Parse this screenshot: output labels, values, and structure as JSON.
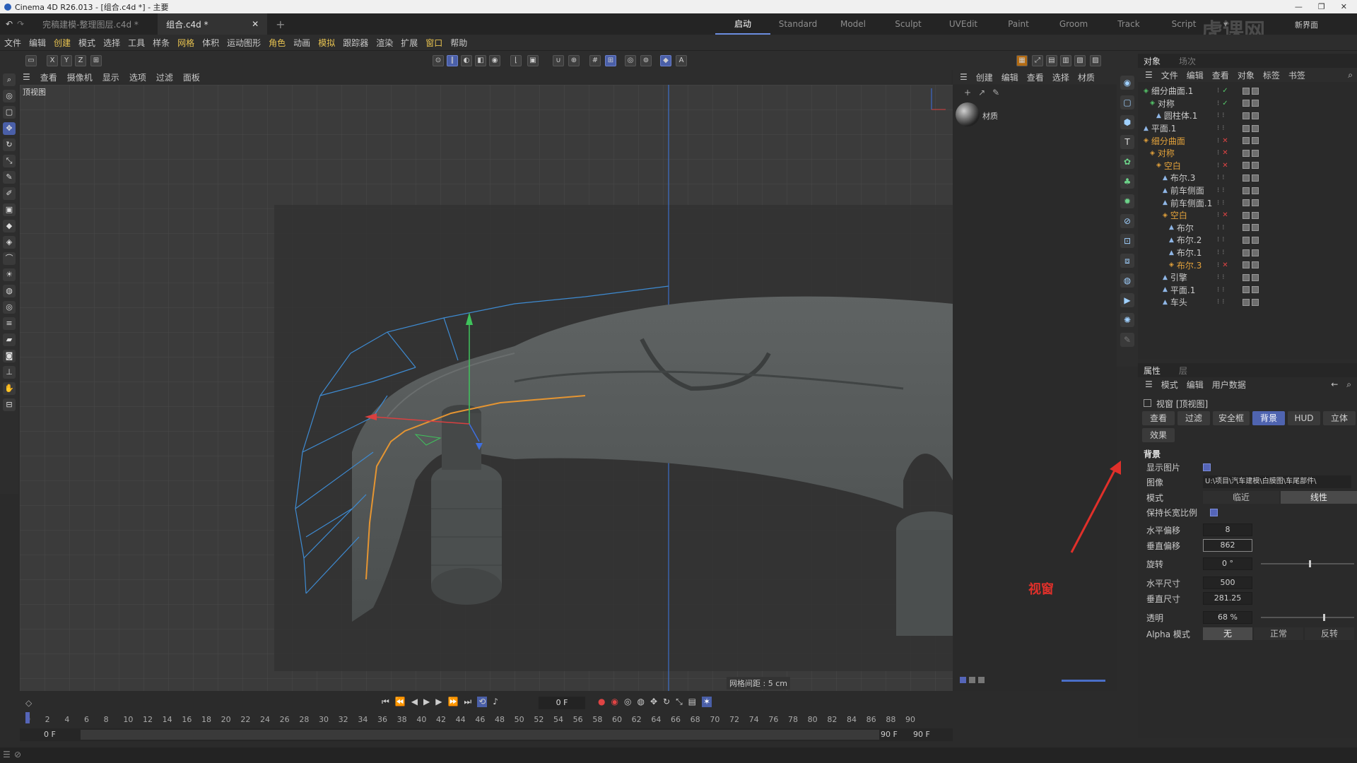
{
  "window": {
    "title": "Cinema 4D R26.013 - [组合.c4d *] - 主要",
    "controls": [
      "—",
      "❐",
      "✕"
    ]
  },
  "tabs": {
    "doc1": "完稿建模-整理图层.c4d *",
    "doc2": "组合.c4d *",
    "add": "+",
    "layouts": [
      "启动",
      "Standard",
      "Model",
      "Sculpt",
      "UVEdit",
      "Paint",
      "Groom",
      "Track",
      "Script"
    ],
    "new_layout": "新界面"
  },
  "menu": [
    "文件",
    "编辑",
    "创建",
    "模式",
    "选择",
    "工具",
    "样条",
    "网格",
    "体积",
    "运动图形",
    "角色",
    "动画",
    "模拟",
    "跟踪器",
    "渲染",
    "扩展",
    "窗口",
    "帮助"
  ],
  "toolbar": {
    "axes": [
      "X",
      "Y",
      "Z"
    ]
  },
  "viewport": {
    "menu": [
      "查看",
      "摄像机",
      "显示",
      "选项",
      "过滤",
      "面板"
    ],
    "label": "顶视图",
    "grid_spacing": "网格间距 : 5 cm"
  },
  "material": {
    "menu": [
      "创建",
      "编辑",
      "查看",
      "选择",
      "材质"
    ],
    "name": "材质"
  },
  "objects": {
    "tabs": [
      "对象",
      "场次"
    ],
    "menu": [
      "文件",
      "编辑",
      "查看",
      "对象",
      "标签",
      "书签"
    ],
    "rows": [
      {
        "name": "细分曲面.1",
        "indent": 0,
        "state": "green"
      },
      {
        "name": "对称",
        "indent": 1,
        "state": "green"
      },
      {
        "name": "圆柱体.1",
        "indent": 2,
        "state": ""
      },
      {
        "name": "平面.1",
        "indent": 0,
        "state": ""
      },
      {
        "name": "细分曲面",
        "indent": 0,
        "state": "orange"
      },
      {
        "name": "对称",
        "indent": 1,
        "state": "orange"
      },
      {
        "name": "空白",
        "indent": 2,
        "state": "orange"
      },
      {
        "name": "布尔.3",
        "indent": 3,
        "state": ""
      },
      {
        "name": "前车侧面",
        "indent": 3,
        "state": ""
      },
      {
        "name": "前车侧面.1",
        "indent": 3,
        "state": ""
      },
      {
        "name": "空白",
        "indent": 3,
        "state": "orange"
      },
      {
        "name": "布尔",
        "indent": 4,
        "state": ""
      },
      {
        "name": "布尔.2",
        "indent": 4,
        "state": ""
      },
      {
        "name": "布尔.1",
        "indent": 4,
        "state": ""
      },
      {
        "name": "布尔.3",
        "indent": 4,
        "state": "orange"
      },
      {
        "name": "引擎",
        "indent": 3,
        "state": ""
      },
      {
        "name": "平面.1",
        "indent": 3,
        "state": ""
      },
      {
        "name": "车头",
        "indent": 3,
        "state": ""
      }
    ]
  },
  "attributes": {
    "tabs": [
      "属性",
      "层"
    ],
    "menu": [
      "模式",
      "编辑",
      "用户数据"
    ],
    "title": "视窗 [顶视图]",
    "subtabs": [
      "查看",
      "过滤",
      "安全框",
      "背景",
      "HUD",
      "立体",
      "效果"
    ],
    "section": "背景",
    "show_image_label": "显示图片",
    "show_image": true,
    "image_label": "图像",
    "image_path": "U:\\项目\\汽车建模\\白膜图\\车尾部件\\",
    "mode_label": "模式",
    "mode_options": [
      "临近",
      "线性"
    ],
    "mode_selected": "线性",
    "keep_ratio_label": "保持长宽比例",
    "keep_ratio": true,
    "h_offset_label": "水平偏移",
    "h_offset": "8",
    "v_offset_label": "垂直偏移",
    "v_offset": "862",
    "rotation_label": "旋转",
    "rotation": "0 °",
    "h_size_label": "水平尺寸",
    "h_size": "500",
    "v_size_label": "垂直尺寸",
    "v_size": "281.25",
    "transparency_label": "透明",
    "transparency": "68 %",
    "alpha_label": "Alpha 模式",
    "alpha_options": [
      "无",
      "正常",
      "反转"
    ],
    "alpha_selected": "无"
  },
  "annotation": {
    "text": "视窗",
    "color": "#e0302a"
  },
  "timeline": {
    "current": "0 F",
    "ticks": [
      "0",
      "2",
      "4",
      "6",
      "8",
      "10",
      "12",
      "14",
      "16",
      "18",
      "20",
      "22",
      "24",
      "26",
      "28",
      "30",
      "32",
      "34",
      "36",
      "38",
      "40",
      "42",
      "44",
      "46",
      "48",
      "50",
      "52",
      "54",
      "56",
      "58",
      "60",
      "62",
      "64",
      "66",
      "68",
      "70",
      "72",
      "74",
      "76",
      "78",
      "80",
      "82",
      "84",
      "86",
      "88",
      "90"
    ],
    "start": "0 F",
    "start2": "0 F",
    "end": "90 F",
    "end2": "90 F"
  },
  "watermark": "虎课网"
}
